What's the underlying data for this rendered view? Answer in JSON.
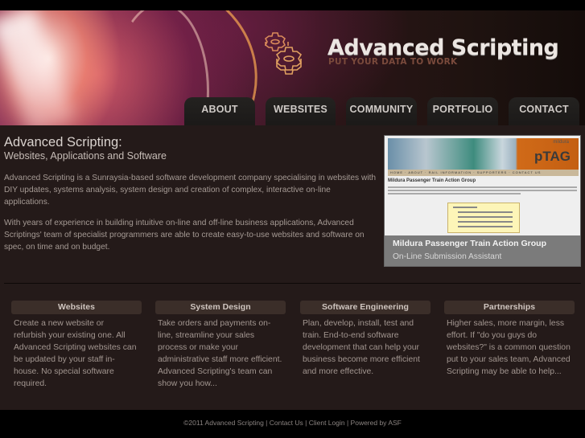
{
  "header": {
    "brand_title": "Advanced Scripting",
    "brand_tagline": "PUT YOUR DATA TO WORK",
    "logo_icon": "gears-icon"
  },
  "nav": {
    "tabs": [
      {
        "label": "ABOUT"
      },
      {
        "label": "WEBSITES"
      },
      {
        "label": "COMMUNITY"
      },
      {
        "label": "PORTFOLIO"
      },
      {
        "label": "CONTACT"
      }
    ]
  },
  "intro": {
    "title": "Advanced Scripting:",
    "subtitle": "Websites, Applications and Software",
    "paragraphs": [
      "Advanced Scripting is a Sunraysia-based software development company specialising in websites with DIY updates, systems analysis, system design and creation of complex, interactive on-line applications.",
      "With years of experience in building intuitive on-line and off-line business applications, Advanced Scriptings' team of specialist programmers are able to create easy-to-use websites and software on spec, on time and on budget."
    ]
  },
  "showcase": {
    "screenshot_heading": "Mildura Passenger Train Action Group",
    "screenshot_logo": "pTAG",
    "screenshot_logo_small": "mildura",
    "caption_title": "Mildura Passenger Train Action Group",
    "caption_subtitle": "On-Line Submission Assistant"
  },
  "services": [
    {
      "title": "Websites",
      "body": "Create a new website or refurbish your existing one. All Advanced Scripting websites can be updated by your staff in-house. No special software required."
    },
    {
      "title": "System Design",
      "body": "Take orders and payments on-line, streamline your sales process or make your administrative staff more efficient. Advanced Scripting's team can show you how..."
    },
    {
      "title": "Software Engineering",
      "body": "Plan, develop, install, test and train. End-to-end software development that can help your business become more efficient and more effective."
    },
    {
      "title": "Partnerships",
      "body": "Higher sales, more margin, less effort. If \"do you guys do websites?\" is a common question put to your sales team, Advanced Scripting may be able to help..."
    }
  ],
  "footer": {
    "copyright": "©2011 Advanced Scripting",
    "separator": " | ",
    "links": [
      "Contact Us",
      "Client Login",
      "Powered by ASF"
    ]
  },
  "colors": {
    "page_bg": "#000000",
    "content_bg": "#241a19",
    "tab_bg": "#1f1d1b",
    "service_title_bg": "#3b2e29",
    "tagline": "#7a4a3c",
    "gear_outline": "#d98a5a"
  }
}
